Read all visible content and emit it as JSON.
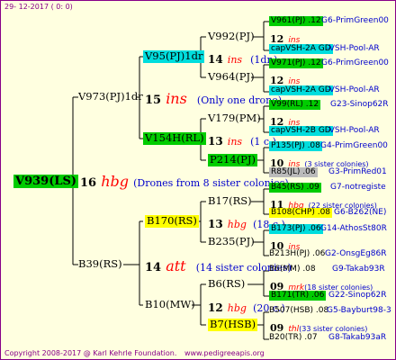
{
  "header": {
    "date": "29- 12-2017 (  0:  0)"
  },
  "footer": {
    "copyright": "Copyright 2008-2017 @ Karl Kehrle Foundation.",
    "website": "www.pedigreeapis.org"
  },
  "root": {
    "label": "V939(LS)",
    "gen": "16",
    "code": "hbg",
    "note": "(Drones from 8 sister colonies)"
  },
  "p1": {
    "label": "V973(PJ)1dr",
    "gen": "15",
    "code": "ins",
    "note": "(Only one drone)"
  },
  "p1a": {
    "label": "V95(PJ)1dr",
    "gen": "14",
    "code": "ins",
    "note": "(1dr.)"
  },
  "p1b": {
    "label": "V154H(RL)",
    "gen": "13",
    "code": "ins",
    "note": "(1 c.)"
  },
  "n992": {
    "label": "V992(PJ)"
  },
  "n964": {
    "label": "V964(PJ)"
  },
  "n179": {
    "label": "V179(PM)"
  },
  "n214": {
    "label": "P214(PJ)"
  },
  "p2": {
    "label": "B39(RS)",
    "gen": "14",
    "code": "att",
    "note": "(14 sister colonies)"
  },
  "p2a": {
    "label": "B170(RS)",
    "gen": "13",
    "code": "hbg",
    "note": "(18 c.)"
  },
  "p2b": {
    "label": "B10(MW)",
    "gen": "12",
    "code": "hbg",
    "note": "(20 c.)"
  },
  "n17": {
    "label": "B17(RS)"
  },
  "n235": {
    "label": "B235(PJ)"
  },
  "n6rs": {
    "label": "B6(RS)"
  },
  "n7": {
    "label": "B7(HSB)"
  },
  "r": {
    "r1": {
      "label": "V961(PJ) .12",
      "mid": "G6",
      "right": "-PrimGreen00"
    },
    "r2": {
      "gen": "12",
      "code": "ins"
    },
    "r3": {
      "label": "capVSH-2A GD",
      "right": "-VSH-Pool-AR"
    },
    "r4": {
      "label": "V971(PJ) .12",
      "mid": "G6",
      "right": "-PrimGreen00"
    },
    "r5": {
      "gen": "12",
      "code": "ins"
    },
    "r6": {
      "label": "capVSH-2A GD",
      "right": "-VSH-Pool-AR"
    },
    "r7": {
      "label": "V99(RL) .12",
      "mid": "G23",
      "right": "-Sinop62R"
    },
    "r8": {
      "gen": "12",
      "code": "ins"
    },
    "r9": {
      "label": "capVSH-2B GD",
      "right": "-VSH-Pool-AR"
    },
    "r10": {
      "label": "P135(PJ) .08",
      "mid": "G4",
      "right": "-PrimGreen00"
    },
    "r11": {
      "gen": "10",
      "code": "ins",
      "note": "(3 sister colonies)"
    },
    "r12": {
      "label": "R85(JL) .06",
      "mid": "G3",
      "right": "-PrimRed01"
    },
    "r13": {
      "label": "B45(RS) .09",
      "mid": "G7",
      "right": "-notregiste"
    },
    "r14": {
      "gen": "11",
      "code": "hbg",
      "note": "(22 sister colonies)"
    },
    "r15": {
      "label": "B108(CHP) .08",
      "mid": "G6",
      "right": "-B262(NE)"
    },
    "r16": {
      "label": "B173(PJ) .06",
      "mid": "G14",
      "right": "-AthosSt80R"
    },
    "r17": {
      "gen": "10",
      "code": "ins"
    },
    "r18": {
      "label": "B213H(PJ) .06",
      "mid": "G2",
      "right": "-OnsgEg86R"
    },
    "r19": {
      "label": "B6(MM) .08",
      "mid": "G9",
      "right": "-Takab93R"
    },
    "r20": {
      "gen": "09",
      "code": "mrk",
      "note": "(18 sister colonies)"
    },
    "r21": {
      "label": "B171(TR) .06",
      "mid": "G22",
      "right": "-Sinop62R"
    },
    "r22": {
      "label": "B507(HSB) .08",
      "mid": "G5",
      "right": "-Bayburt98-3"
    },
    "r23": {
      "gen": "09",
      "code": "thl",
      "note": "(33 sister colonies)"
    },
    "r24": {
      "label": "B20(TR) .07",
      "mid": "G8",
      "right": "-Takab93aR"
    }
  },
  "colors": {
    "green": "#00cc00",
    "cyan": "#00dddd",
    "yellow": "#ffff00",
    "gray": "#bbbbbb",
    "border": "#880088",
    "background": "#ffffe0",
    "line": "#000000",
    "note": "#0000cc",
    "code": "#ff0000"
  }
}
